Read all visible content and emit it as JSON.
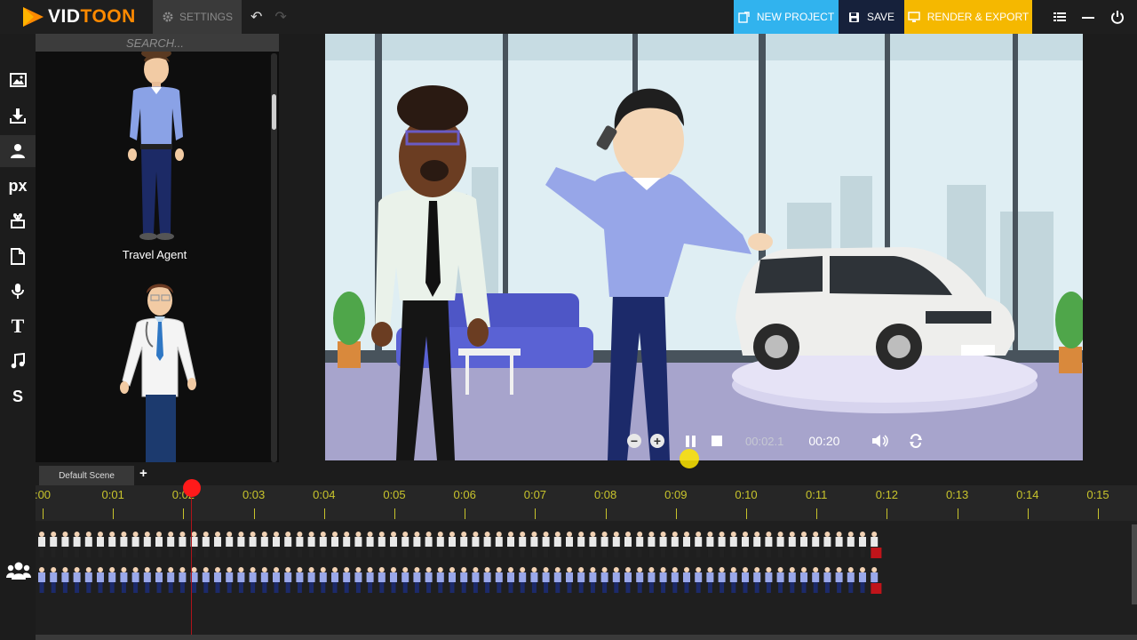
{
  "app": {
    "logo_part1": "VID",
    "logo_part2": "TOON"
  },
  "toolbar": {
    "settings_label": "SETTINGS",
    "new_project_label": "NEW PROJECT",
    "save_label": "SAVE",
    "render_label": "RENDER & EXPORT"
  },
  "sidebar": {
    "items": [
      {
        "name": "image-icon",
        "glyph": ""
      },
      {
        "name": "download-icon",
        "glyph": ""
      },
      {
        "name": "character-icon",
        "glyph": ""
      },
      {
        "name": "pixabay-icon",
        "glyph": "px"
      },
      {
        "name": "props-icon",
        "glyph": ""
      },
      {
        "name": "document-icon",
        "glyph": ""
      },
      {
        "name": "microphone-icon",
        "glyph": ""
      },
      {
        "name": "text-icon",
        "glyph": "T"
      },
      {
        "name": "music-icon",
        "glyph": ""
      },
      {
        "name": "storyblocks-icon",
        "glyph": "S"
      }
    ]
  },
  "panel": {
    "search_placeholder": "SEARCH...",
    "assets": [
      {
        "label": "Travel Agent"
      },
      {
        "label": ""
      }
    ]
  },
  "player": {
    "current_time": "00:02.1",
    "total_time": "00:20"
  },
  "scenes": {
    "tab_label": "Default Scene",
    "add_label": "+"
  },
  "timeline": {
    "ticks": [
      ":00",
      "0:01",
      "0:02",
      "0:03",
      "0:04",
      "0:05",
      "0:06",
      "0:07",
      "0:08",
      "0:09",
      "0:10",
      "0:11",
      "0:12",
      "0:13",
      "0:14",
      "0:15"
    ],
    "playhead_seconds": 2.1
  },
  "colors": {
    "new_project": "#31b3ee",
    "save": "#16213b",
    "render": "#f5b800",
    "playhead": "#ff1a1a",
    "ruler_text": "#c8c42c"
  }
}
